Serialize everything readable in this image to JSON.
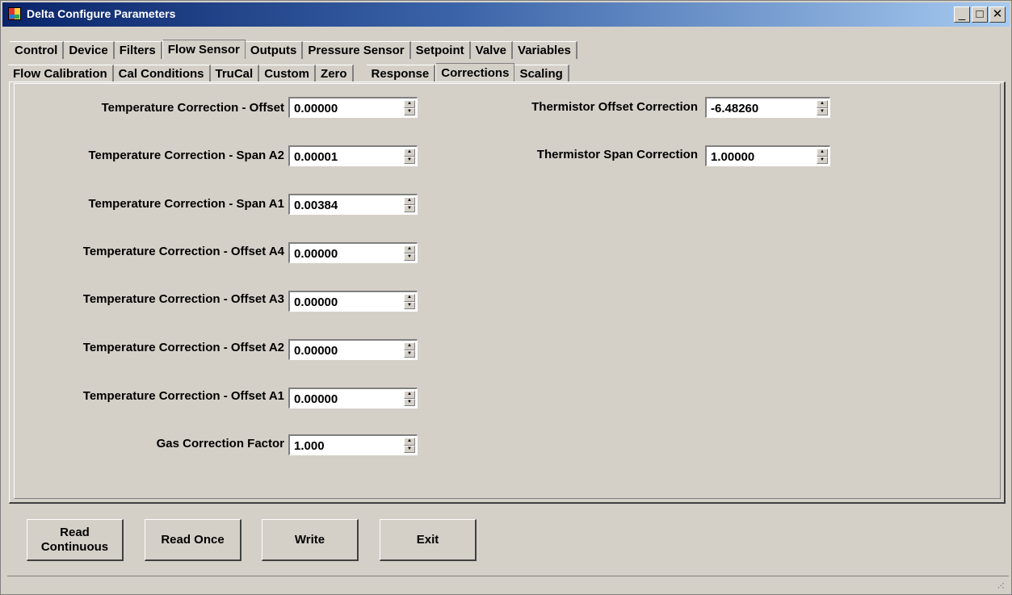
{
  "window": {
    "title": "Delta Configure Parameters"
  },
  "main_tabs": [
    "Control",
    "Device",
    "Filters",
    "Flow Sensor",
    "Outputs",
    "Pressure Sensor",
    "Setpoint",
    "Valve",
    "Variables"
  ],
  "main_tab_active": "Flow Sensor",
  "sub_tabs": [
    "Flow Calibration",
    "Cal Conditions",
    "TruCal",
    "Custom",
    "Zero",
    "Response",
    "Corrections",
    "Scaling"
  ],
  "sub_tab_active": "Corrections",
  "left_fields": [
    {
      "label": "Temperature Correction - Offset",
      "value": "0.00000"
    },
    {
      "label": "Temperature Correction - Span A2",
      "value": "0.00001"
    },
    {
      "label": "Temperature Correction - Span A1",
      "value": "0.00384"
    },
    {
      "label": "Temperature Correction - Offset A4",
      "value": "0.00000"
    },
    {
      "label": "Temperature Correction - Offset A3",
      "value": "0.00000"
    },
    {
      "label": "Temperature Correction - Offset A2",
      "value": "0.00000"
    },
    {
      "label": "Temperature Correction - Offset A1",
      "value": "0.00000"
    },
    {
      "label": "Gas Correction Factor",
      "value": "1.000"
    }
  ],
  "right_fields": [
    {
      "label": "Thermistor Offset Correction",
      "value": "-6.48260"
    },
    {
      "label": "Thermistor Span Correction",
      "value": "1.00000"
    }
  ],
  "buttons": {
    "read_continuous_line1": "Read",
    "read_continuous_line2": "Continuous",
    "read_once": "Read Once",
    "write": "Write",
    "exit": "Exit"
  },
  "icons": {
    "spin_up": "▲",
    "spin_down": "▼",
    "minimize": "_",
    "maximize": "□",
    "close": "✕",
    "grip": "⠠⠪"
  }
}
